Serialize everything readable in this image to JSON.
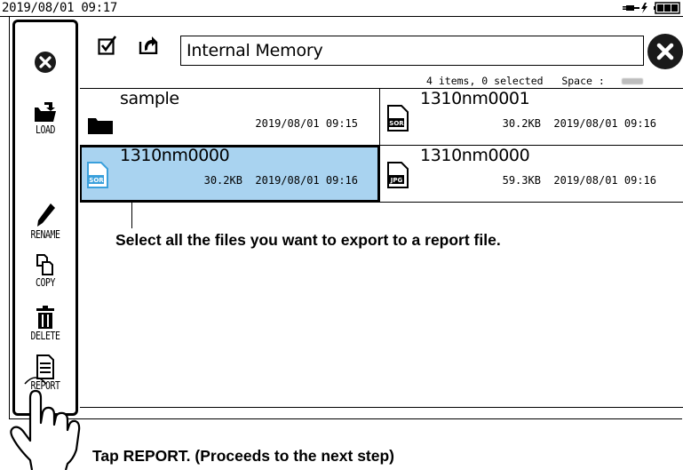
{
  "status_bar": {
    "datetime": "2019/08/01 09:17"
  },
  "sidebar": {
    "items": [
      {
        "icon": "close-circle-icon",
        "label": ""
      },
      {
        "icon": "open-folder-icon",
        "label": "LOAD"
      },
      {
        "icon": "pencil-icon",
        "label": "RENAME"
      },
      {
        "icon": "copy-icon",
        "label": "COPY"
      },
      {
        "icon": "trash-icon",
        "label": "DELETE"
      },
      {
        "icon": "report-icon",
        "label": "REPORT"
      }
    ]
  },
  "toolbar": {
    "location": "Internal Memory",
    "info": "4 items, 0 selected   Space :"
  },
  "files": [
    {
      "name": "sample",
      "type": "folder",
      "size": "",
      "date": "2019/08/01 09:15",
      "selected": false
    },
    {
      "name": "1310nm0001",
      "type": "SOR",
      "size": "30.2KB",
      "date": "2019/08/01 09:16",
      "selected": false
    },
    {
      "name": "1310nm0000",
      "type": "SOR",
      "size": "30.2KB",
      "date": "2019/08/01 09:16",
      "selected": true
    },
    {
      "name": "1310nm0000",
      "type": "JPG",
      "size": "59.3KB",
      "date": "2019/08/01 09:16",
      "selected": false
    }
  ],
  "callout": "Select all the files you want to export to a report file.",
  "instruction": "Tap REPORT. (Proceeds to the next step)",
  "colors": {
    "selected_tile": "#a9d3f0",
    "sor_icon": "#3aa0dc",
    "text": "#000000"
  }
}
